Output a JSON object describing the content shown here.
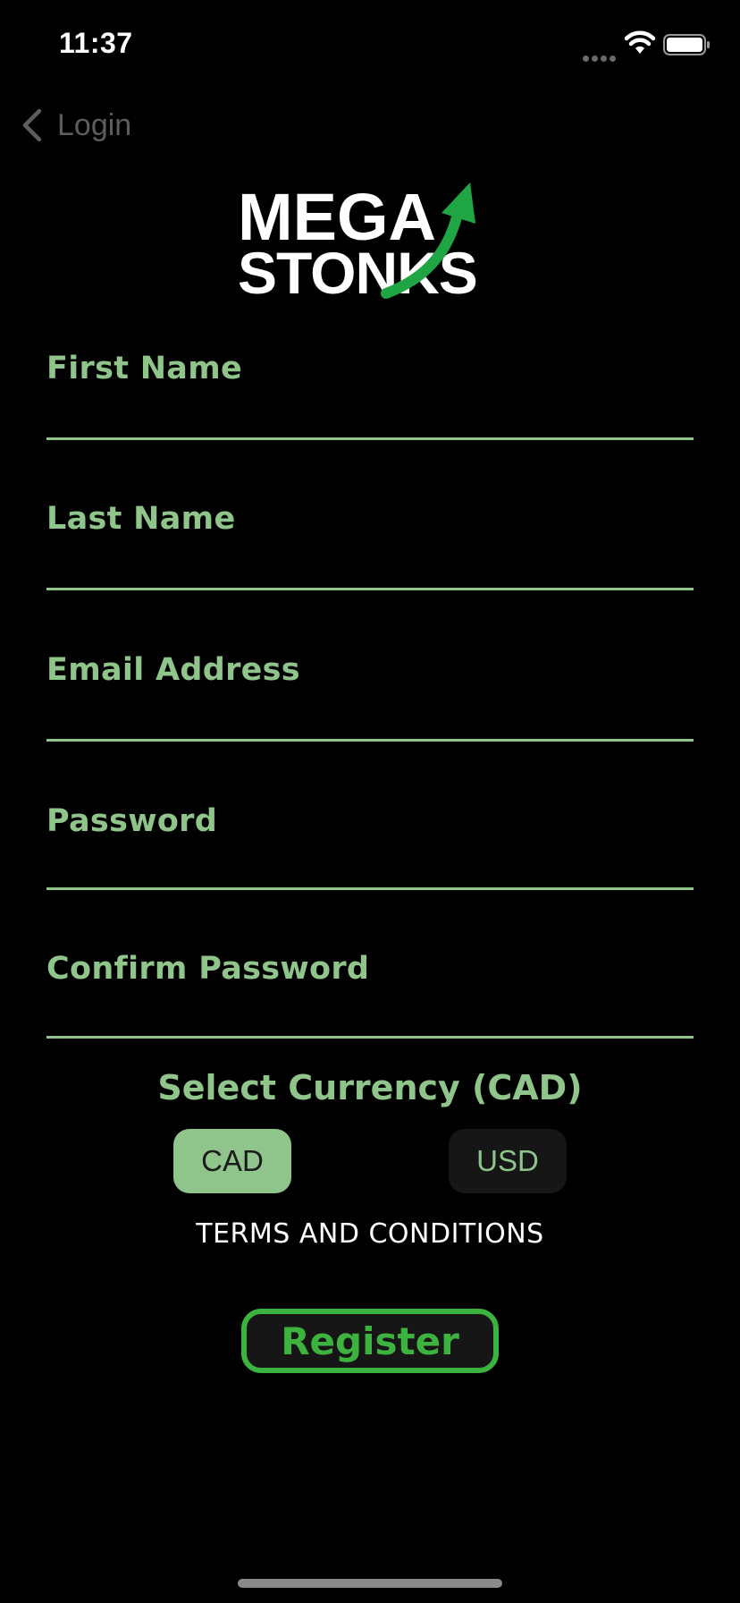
{
  "status_bar": {
    "time": "11:37"
  },
  "nav": {
    "back_label": "Login"
  },
  "logo": {
    "line1": "MEGA",
    "line2": "STONKS"
  },
  "form": {
    "first_name_label": "First Name",
    "last_name_label": "Last Name",
    "email_label": "Email Address",
    "password_label": "Password",
    "confirm_password_label": "Confirm Password"
  },
  "currency": {
    "title": "Select Currency (CAD)",
    "options": [
      "CAD",
      "USD"
    ],
    "selected": "CAD"
  },
  "terms_label": "TERMS AND CONDITIONS",
  "register_label": "Register",
  "colors": {
    "accent": "#8fc48b",
    "register_green": "#3db33f",
    "background": "#000000"
  }
}
